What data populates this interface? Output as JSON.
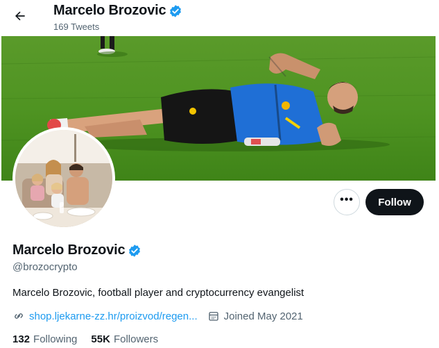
{
  "header": {
    "name": "Marcelo Brozovic",
    "tweet_count": "169 Tweets"
  },
  "profile": {
    "name": "Marcelo Brozovic",
    "handle": "@brozocrypto",
    "bio": "Marcelo Brozovic, football player and cryptocurrency evangelist",
    "link": "shop.ljekarne-zz.hr/proizvod/regen...",
    "joined": "Joined May 2021"
  },
  "actions": {
    "more_label": "•••",
    "follow_label": "Follow"
  },
  "stats": {
    "following_count": "132",
    "following_label": "Following",
    "followers_count": "55K",
    "followers_label": "Followers"
  },
  "icons": {
    "back": "arrow-left-icon",
    "verified": "verified-badge-icon",
    "link": "link-icon",
    "calendar": "calendar-icon"
  },
  "colors": {
    "verified": "#1d9bf0",
    "link": "#1d9bf0",
    "follow_button": "#0f1419",
    "secondary_text": "#536471"
  }
}
